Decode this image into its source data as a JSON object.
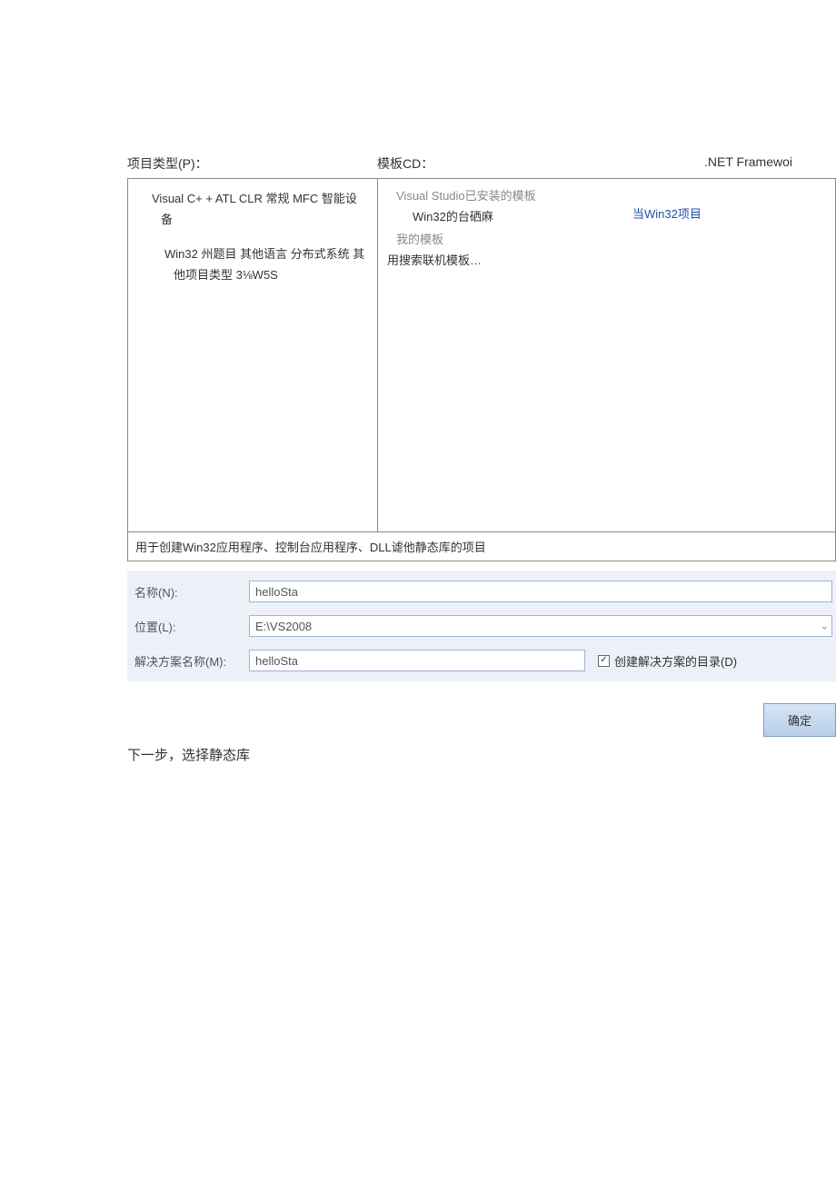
{
  "headers": {
    "project_type": "项目类型(P)：",
    "templates": "模板CD：",
    "framework": ".NET Framewoi"
  },
  "tree": {
    "line1": "Visual C+ + ATL CLR 常规 MFC 智能设备",
    "line2": "Win32 州题目 其他语言 分布式系统 其他项目类型 3⅛W5S"
  },
  "templates": {
    "installed_title": "Visual Studio已安装的模板",
    "item1": "Win32的台硒麻",
    "selected": "当Win32项目",
    "my_title": "我的模板",
    "search_online": "用搜索联机模板…"
  },
  "description": "用于创建Win32应用程序、控制台应用程序、DLL谑他静态库的项目",
  "form": {
    "name_label": "名称(N):",
    "name_value": "helloSta",
    "location_label": "位置(L):",
    "location_value": "E:\\VS2008",
    "solution_label": "解决方案名称(M):",
    "solution_value": "helloSta",
    "checkbox_label": "创建解决方案的目录(D)"
  },
  "buttons": {
    "ok": "确定"
  },
  "footer": "下一步，选择静态库"
}
